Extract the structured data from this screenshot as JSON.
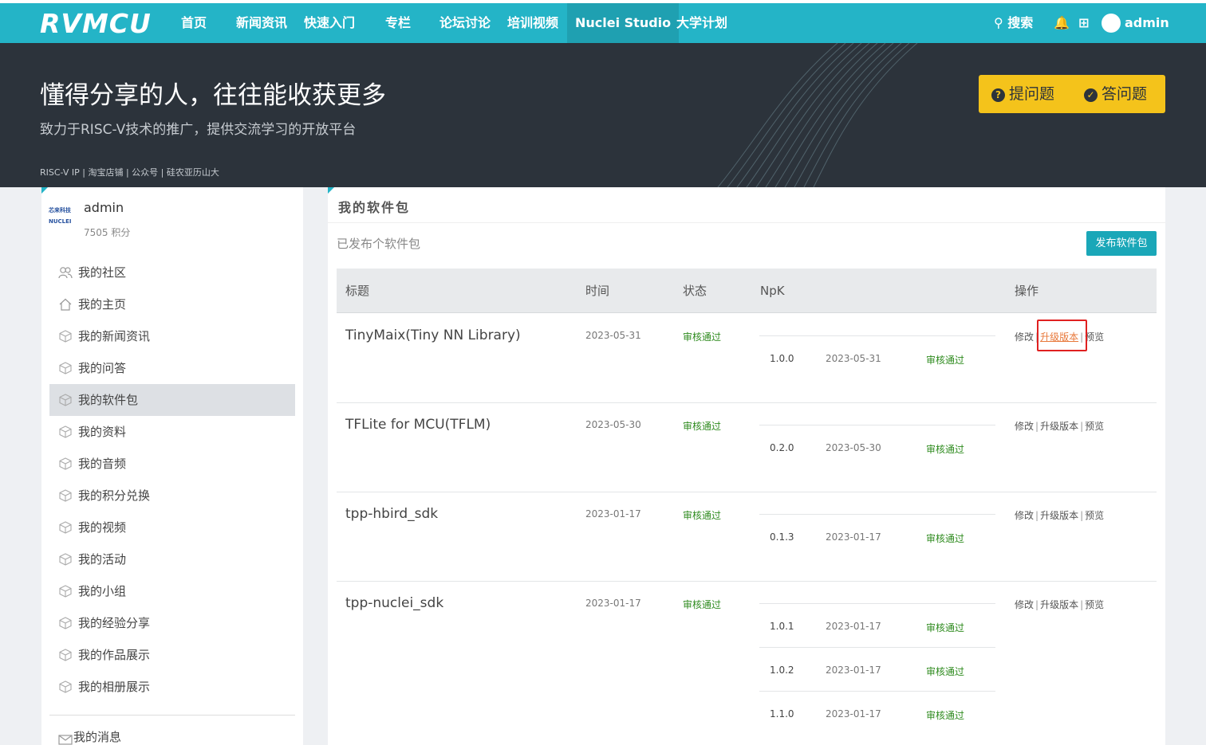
{
  "nav": {
    "logo": "RVMCU",
    "items": [
      "首页",
      "新闻资讯",
      "快速入门",
      "专栏",
      "论坛讨论",
      "培训视频",
      "Nuclei Studio",
      "大学计划"
    ],
    "active_index": 6,
    "search": "搜索",
    "user": "admin"
  },
  "hero": {
    "title": "懂得分享的人，往往能收获更多",
    "subtitle": "致力于RISC-V技术的推广，提供交流学习的开放平台",
    "links": "RISC-V IP | 淘宝店铺 | 公众号 | 硅农亚历山大",
    "ask_button": "提问题",
    "answer_button": "答问题"
  },
  "sidebar": {
    "logo_text": "芯来科技 NUCLEI",
    "username": "admin",
    "points": "7505 积分",
    "items": [
      "我的社区",
      "我的主页",
      "我的新闻资讯",
      "我的问答",
      "我的软件包",
      "我的资料",
      "我的音频",
      "我的积分兑换",
      "我的视频",
      "我的活动",
      "我的小组",
      "我的经验分享",
      "我的作品展示",
      "我的相册展示"
    ],
    "active_index": 4,
    "messages": "我的消息"
  },
  "main": {
    "title": "我的软件包",
    "subtitle": "已发布个软件包",
    "publish_button": "发布软件包",
    "columns": [
      "标题",
      "时间",
      "状态",
      "NpK",
      "操作"
    ],
    "ops": [
      "修改",
      "升级版本",
      "预览"
    ],
    "packages": [
      {
        "title": "TinyMaix(Tiny NN Library)",
        "date": "2023-05-31",
        "status": "审核通过",
        "versions": [
          {
            "version": "1.0.0",
            "date": "2023-05-31",
            "status": "审核通过"
          }
        ]
      },
      {
        "title": "TFLite for MCU(TFLM)",
        "date": "2023-05-30",
        "status": "审核通过",
        "versions": [
          {
            "version": "0.2.0",
            "date": "2023-05-30",
            "status": "审核通过"
          }
        ]
      },
      {
        "title": "tpp-hbird_sdk",
        "date": "2023-01-17",
        "status": "审核通过",
        "versions": [
          {
            "version": "0.1.3",
            "date": "2023-01-17",
            "status": "审核通过"
          }
        ]
      },
      {
        "title": "tpp-nuclei_sdk",
        "date": "2023-01-17",
        "status": "审核通过",
        "versions": [
          {
            "version": "1.0.1",
            "date": "2023-01-17",
            "status": "审核通过"
          },
          {
            "version": "1.0.2",
            "date": "2023-01-17",
            "status": "审核通过"
          },
          {
            "version": "1.1.0",
            "date": "2023-01-17",
            "status": "审核通过"
          }
        ]
      }
    ]
  },
  "colors": {
    "nav": "#24b4c7",
    "hero": "#2c333b",
    "accent": "#f4c31b",
    "status": "#2e8b1e",
    "highlight": "#e02020"
  }
}
